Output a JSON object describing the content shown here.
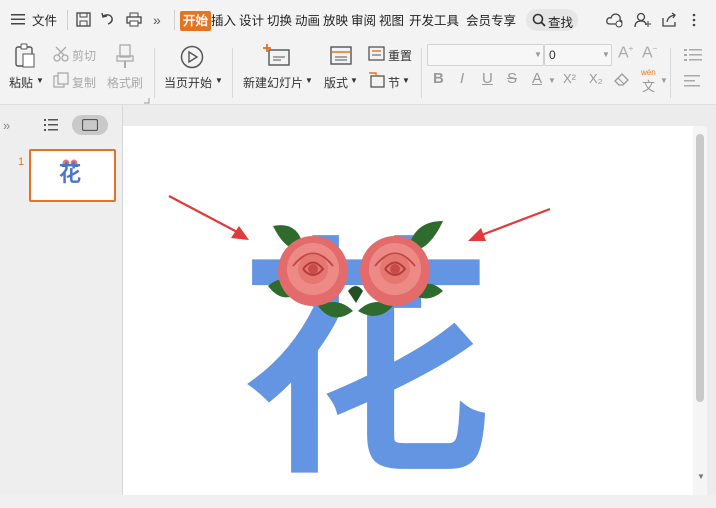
{
  "menu": {
    "file": "文件",
    "tabs": [
      "开始",
      "插入",
      "设计",
      "切换",
      "动画",
      "放映",
      "审阅",
      "视图",
      "开发工具",
      "会员专享"
    ],
    "search": "查找"
  },
  "ribbon": {
    "paste": "粘贴",
    "cut": "剪切",
    "copy": "复制",
    "format_painter": "格式刷",
    "play_from_start": "当页开始",
    "new_slide": "新建幻灯片",
    "layout": "版式",
    "reset": "重置",
    "section": "节",
    "font_name": "",
    "font_size": "0"
  },
  "format_buttons": {
    "bold": "B",
    "italic": "I",
    "underline": "U",
    "strike": "S",
    "color": "A",
    "superscript": "X²",
    "subscript": "X₂",
    "pinyin": "wén"
  },
  "slide_panel": {
    "slide_number": "1",
    "thumb_text": "花"
  },
  "slide": {
    "char": "花",
    "char_color": "#6495e2",
    "arrow_color": "#e23a3a"
  },
  "colors": {
    "accent": "#e7731f"
  }
}
